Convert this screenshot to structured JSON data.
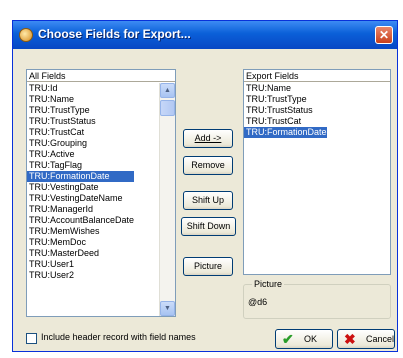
{
  "window": {
    "title": "Choose Fields for Export...",
    "close_glyph": "✕"
  },
  "all_fields": {
    "header": "All Fields",
    "items": [
      "TRU:Id",
      "TRU:Name",
      "TRU:TrustType",
      "TRU:TrustStatus",
      "TRU:TrustCat",
      "TRU:Grouping",
      "TRU:Active",
      "TRU:TagFlag",
      "TRU:FormationDate",
      "TRU:VestingDate",
      "TRU:VestingDateName",
      "TRU:ManagerId",
      "TRU:AccountBalanceDate",
      "TRU:MemWishes",
      "TRU:MemDoc",
      "TRU:MasterDeed",
      "TRU:User1",
      "TRU:User2"
    ],
    "selected_index": 8
  },
  "export_fields": {
    "header": "Export Fields",
    "items": [
      "TRU:Name",
      "TRU:TrustType",
      "TRU:TrustStatus",
      "TRU:TrustCat",
      "TRU:FormationDate"
    ],
    "selected_index": 4
  },
  "buttons": {
    "add": "Add ->",
    "remove": "Remove",
    "shift_up": "Shift Up",
    "shift_down": "Shift Down",
    "picture": "Picture",
    "ok": "OK",
    "cancel": "Cancel"
  },
  "picture": {
    "label": "Picture",
    "value": "@d6"
  },
  "options": {
    "include_header_label": "Include header record with field names",
    "include_header_checked": false
  },
  "colors": {
    "titlebar": "#0a5fd8",
    "selection": "#316ac5",
    "ok_icon": "#2a9d2a",
    "cancel_icon": "#cc1111"
  },
  "icons": {
    "ok": "checkmark-icon",
    "cancel": "x-icon"
  }
}
